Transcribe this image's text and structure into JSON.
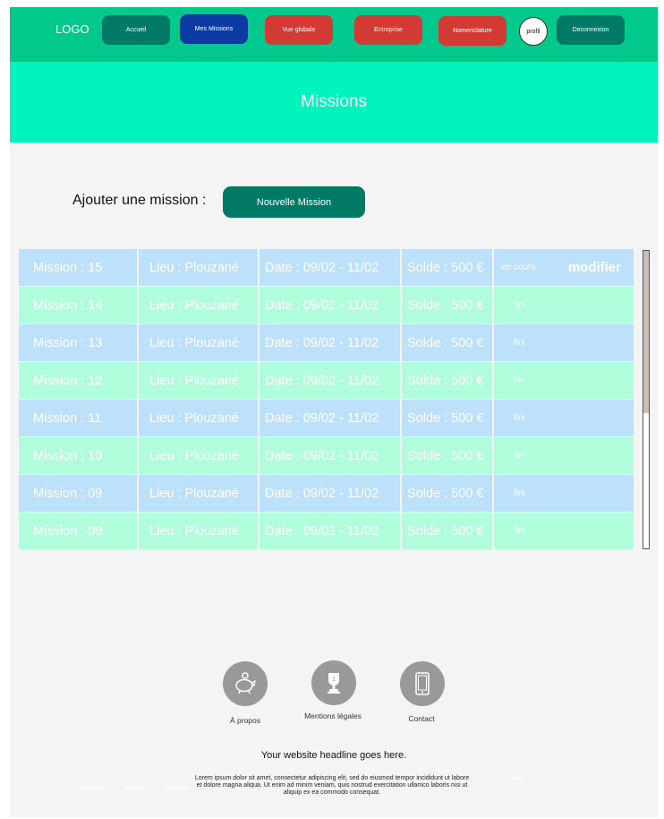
{
  "nav": {
    "logo": "LOGO",
    "accueil": "Accueil",
    "mes_missions": "Mes Missions",
    "vue_globale": "Vue globale",
    "entreprise": "Entreprise",
    "nomenclature": "Nomenclature",
    "profil": "profil",
    "deconnexion": "Deconnexion"
  },
  "page_title": "Missions",
  "add": {
    "label": "Ajouter une mission :",
    "button": "Nouvelle Mission"
  },
  "missions": [
    {
      "mission": "Mission : 15",
      "lieu": "Lieu : Plouzané",
      "date": "Date : 09/02 - 11/02",
      "solde": "Solde : 500 €",
      "status": "en cours",
      "action": "modifier"
    },
    {
      "mission": "Mission : 14",
      "lieu": "Lieu : Plouzané",
      "date": "Date : 09/02 - 11/02",
      "solde": "Solde : 500 €",
      "status": "fini"
    },
    {
      "mission": "Mission : 13",
      "lieu": "Lieu : Plouzané",
      "date": "Date : 09/02 - 11/02",
      "solde": "Solde : 500 €",
      "status": "fini"
    },
    {
      "mission": "Mission : 12",
      "lieu": "Lieu : Plouzané",
      "date": "Date : 09/02 - 11/02",
      "solde": "Solde : 500 €",
      "status": "fini"
    },
    {
      "mission": "Mission : 11",
      "lieu": "Lieu : Plouzané",
      "date": "Date : 09/02 - 11/02",
      "solde": "Solde : 500 €",
      "status": "fini"
    },
    {
      "mission": "Mission : 10",
      "lieu": "Lieu : Plouzané",
      "date": "Date : 09/02 - 11/02",
      "solde": "Solde : 500 €",
      "status": "fini"
    },
    {
      "mission": "Mission : 09",
      "lieu": "Lieu : Plouzané",
      "date": "Date : 09/02 - 11/02",
      "solde": "Solde : 500 €",
      "status": "fini"
    },
    {
      "mission": "Mission : 08",
      "lieu": "Lieu : Plouzané",
      "date": "Date : 09/02 - 11/02",
      "solde": "Solde : 500 €",
      "status": "fini"
    }
  ],
  "footer": {
    "a_propos": "À propos",
    "mentions": "Mentions légales",
    "contact": "Contact",
    "headline": "Your website headline goes here.",
    "lorem": "Lorem ipsum dolor sit amet, consectetur adipiscing elit, sed do eiusmod tempor incididunt ut labore et dolore magna aliqua. Ut enim ad minim veniam, quis nostrud exercitation ullamco laboris nisi ut aliquip ex ea commodo consequat.",
    "link_products": "Products",
    "link_pricing": "Pricing",
    "link_solutions": "Solutions",
    "link_faint_right": "Lorem"
  },
  "colors": {
    "nav_bg": "#00c98b",
    "hero_bg": "#00f4bb",
    "btn_green": "#007a64",
    "btn_blue": "#0a3ba3",
    "btn_red": "#d33a33",
    "row_blue": "#bde0fb",
    "row_green": "#b1fedc"
  }
}
